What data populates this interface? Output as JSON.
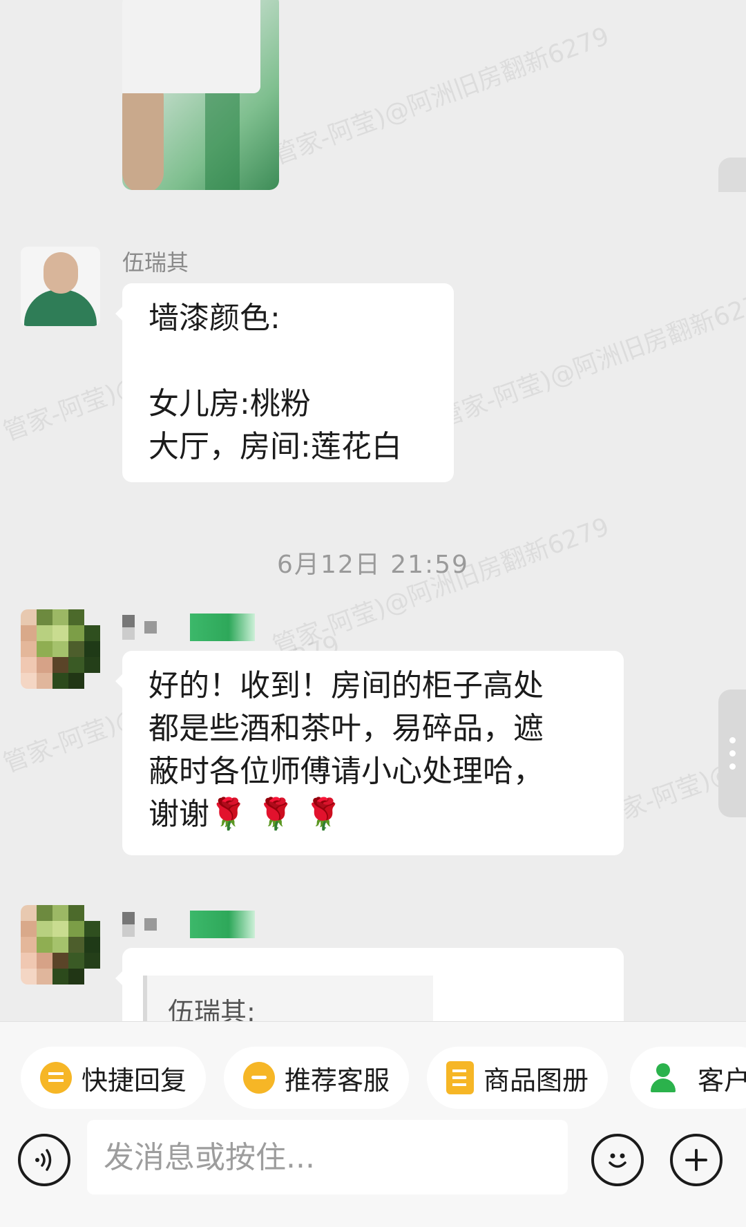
{
  "watermark": "管家-阿莹)@阿洲旧房翻新6279",
  "messages": [
    {
      "sender": "伍瑞其",
      "lines": [
        "墙漆颜色:",
        "",
        "女儿房:桃粉",
        "大厅，房间:莲花白"
      ]
    }
  ],
  "timestamp": "6月12日  21:59",
  "reply": {
    "lines": [
      "好的！收到！房间的柜子高处",
      "都是些酒和茶叶，易碎品，遮",
      "蔽时各位师傅请小心处理哈，",
      "谢谢🌹 🌹 🌹"
    ]
  },
  "quoted": {
    "text": "伍瑞其:"
  },
  "quick_actions": [
    {
      "label": "快捷回复",
      "icon": "quick-reply-icon"
    },
    {
      "label": "推荐客服",
      "icon": "recommend-service-icon"
    },
    {
      "label": "商品图册",
      "icon": "product-album-icon"
    },
    {
      "label": "客户",
      "icon": "customer-icon"
    }
  ],
  "input": {
    "placeholder": "发消息或按住..."
  },
  "buttons": {
    "voice": "voice-icon",
    "emoji": "emoji-icon",
    "plus": "plus-icon"
  }
}
